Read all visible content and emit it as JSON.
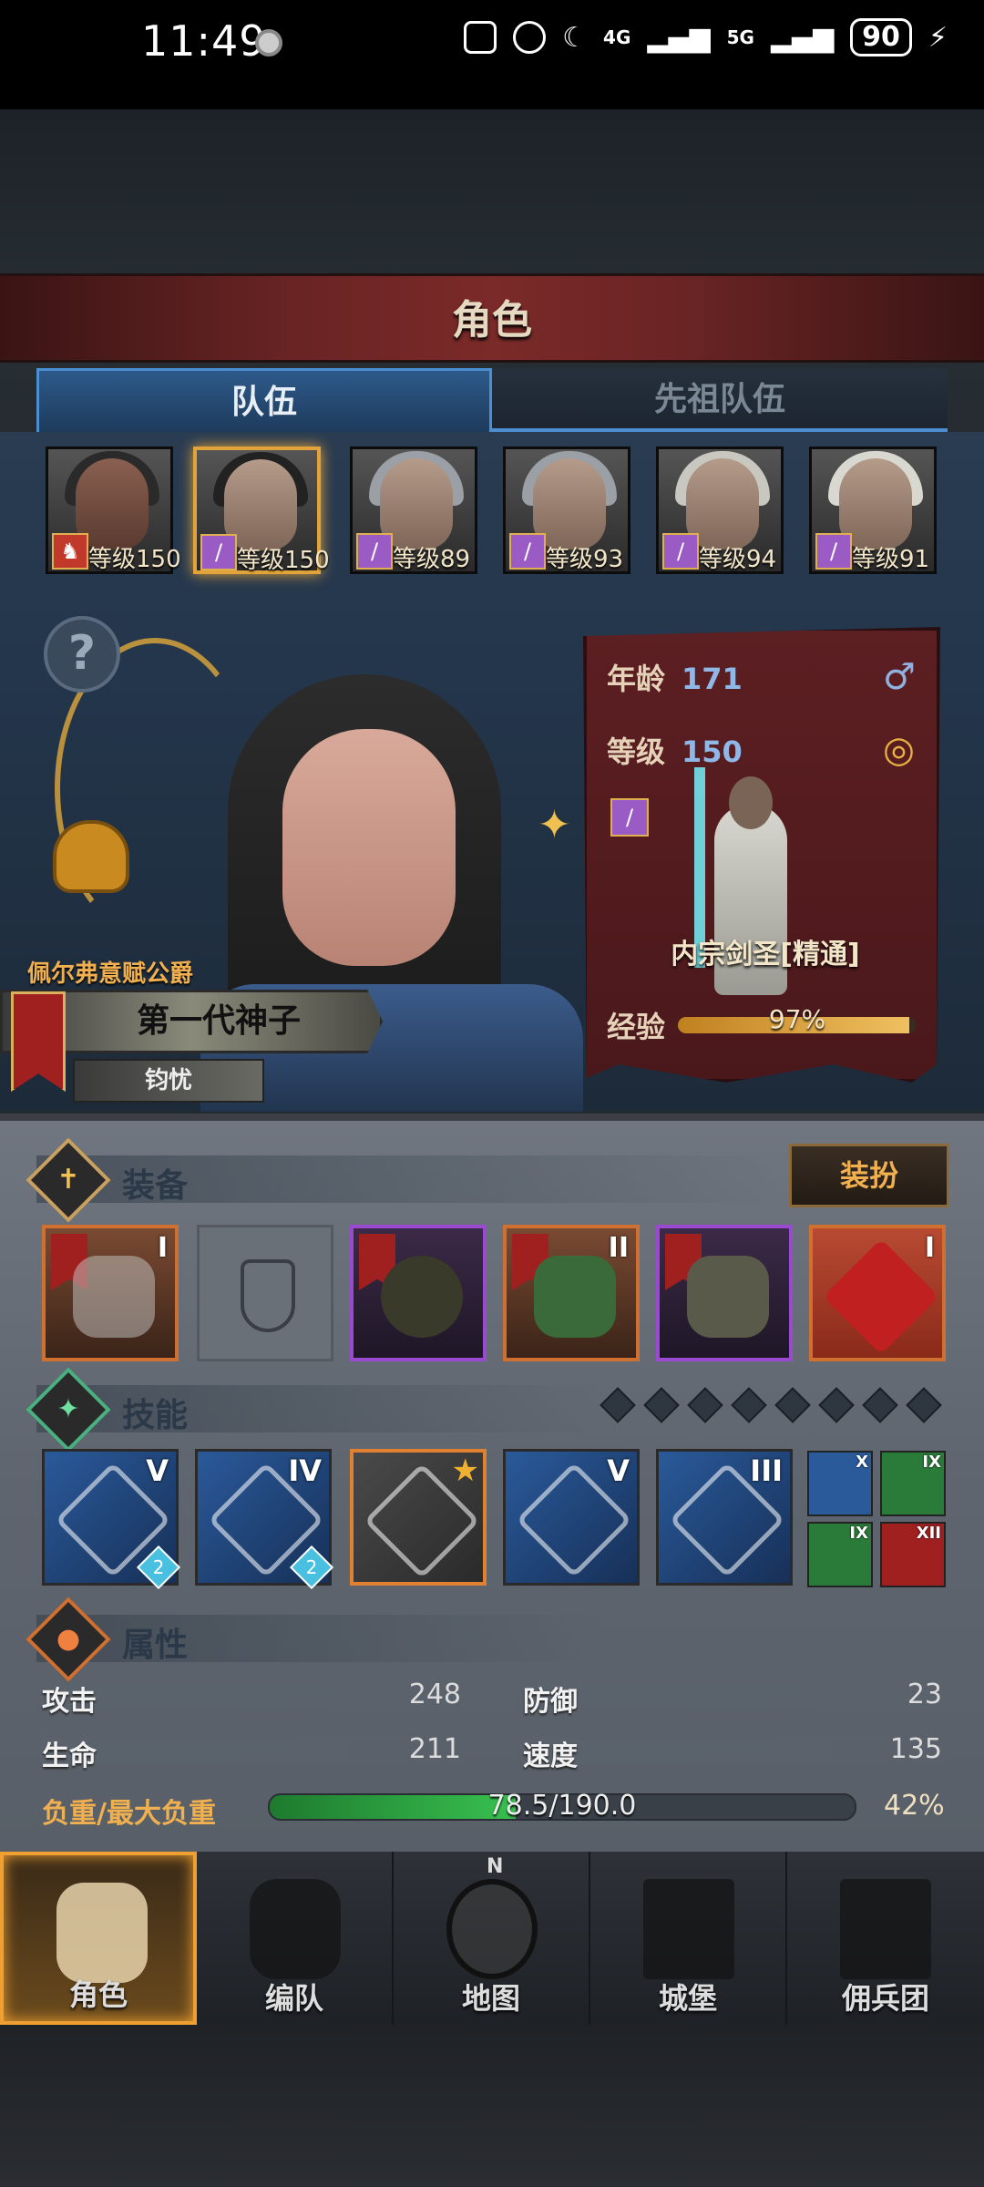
{
  "status_bar": {
    "time": "11:49",
    "network_1": "4G",
    "network_2": "5G",
    "battery": "90",
    "icons": [
      "nfc-icon",
      "alarm-icon",
      "moon-icon",
      "signal-icon",
      "signal-icon",
      "battery-icon",
      "charging-icon"
    ]
  },
  "header": {
    "title": "角色"
  },
  "tabs": [
    {
      "label": "队伍",
      "active": true
    },
    {
      "label": "先祖队伍",
      "active": false
    }
  ],
  "roster": [
    {
      "level": "等级150",
      "class_icon": "horse-icon",
      "selected": false
    },
    {
      "level": "等级150",
      "class_icon": "staff-icon",
      "selected": true
    },
    {
      "level": "等级89",
      "class_icon": "staff-icon",
      "selected": false
    },
    {
      "level": "等级93",
      "class_icon": "staff-icon",
      "selected": false
    },
    {
      "level": "等级94",
      "class_icon": "staff-icon",
      "selected": false
    },
    {
      "level": "等级91",
      "class_icon": "staff-icon",
      "selected": false
    }
  ],
  "hero": {
    "help_symbol": "?",
    "noble_title": "佩尔弗意赋公爵",
    "title_main": "第一代神子",
    "title_sub": "钧忧"
  },
  "info": {
    "age_label": "年龄",
    "age_value": "171",
    "level_label": "等级",
    "level_value": "150",
    "gender_symbol": "♂",
    "class_name": "内宗剑圣[精通]",
    "exp_label": "经验",
    "exp_percent_text": "97%",
    "exp_fraction": 0.97
  },
  "equipment": {
    "title": "装备",
    "dress_button": "装扮",
    "slots": [
      {
        "name": "weapon",
        "rank": "I",
        "style": "orange"
      },
      {
        "name": "empty-shield",
        "rank": "",
        "style": "empty"
      },
      {
        "name": "helmet",
        "rank": "",
        "style": "purple"
      },
      {
        "name": "armor",
        "rank": "II",
        "style": "orange"
      },
      {
        "name": "boots",
        "rank": "",
        "style": "purple"
      },
      {
        "name": "charm",
        "rank": "I",
        "style": "orange"
      }
    ]
  },
  "skills": {
    "title": "技能",
    "main": [
      {
        "rank": "V",
        "badge": "2",
        "style": "blue"
      },
      {
        "rank": "IV",
        "badge": "2",
        "style": "blue"
      },
      {
        "rank": "",
        "badge": "",
        "style": "gold"
      },
      {
        "rank": "V",
        "badge": "",
        "style": "blue"
      },
      {
        "rank": "III",
        "badge": "",
        "style": "blue"
      }
    ],
    "minor": [
      {
        "rank": "X",
        "color": "#2a5a9a"
      },
      {
        "rank": "IX",
        "color": "#2a7a3a"
      },
      {
        "rank": "IX",
        "color": "#2a7a3a"
      },
      {
        "rank": "XII",
        "color": "#a02020"
      }
    ]
  },
  "attributes": {
    "title": "属性",
    "attack_label": "攻击",
    "attack_value": "248",
    "defense_label": "防御",
    "defense_value": "23",
    "hp_label": "生命",
    "hp_value": "211",
    "speed_label": "速度",
    "speed_value": "135",
    "load_label": "负重/最大负重",
    "load_text": "78.5/190.0",
    "load_percent_text": "42%",
    "load_fraction": 0.42
  },
  "nav": [
    {
      "label": "角色",
      "icon": "knight-icon",
      "active": true
    },
    {
      "label": "编队",
      "icon": "helmet-icon",
      "active": false
    },
    {
      "label": "地图",
      "icon": "compass-icon",
      "active": false
    },
    {
      "label": "城堡",
      "icon": "castle-icon",
      "active": false
    },
    {
      "label": "佣兵团",
      "icon": "banner-icon",
      "active": false
    }
  ],
  "compass_n": "N"
}
